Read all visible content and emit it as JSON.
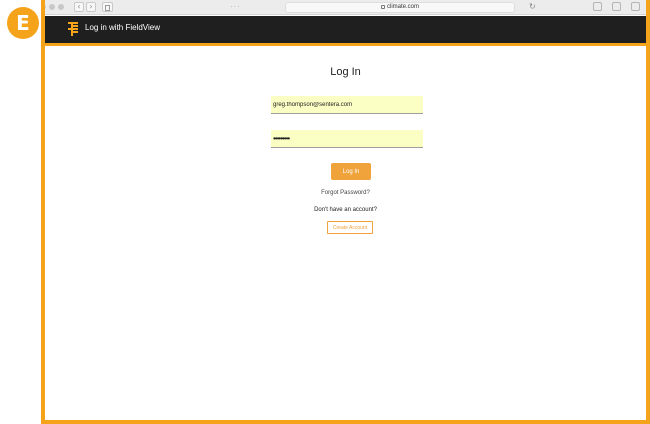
{
  "step_badge": "E",
  "browser": {
    "url": "climate.com",
    "colors": {
      "chrome_bg": "#ececec"
    }
  },
  "header": {
    "title": "Log in with FieldView",
    "logo_icon": "fieldview-logo-icon",
    "colors": {
      "bar": "#1f1f1f",
      "accent": "#f5a31a"
    }
  },
  "login": {
    "title": "Log In",
    "email_value": "greg.thompson@sentera.com",
    "password_value": "•••••••••",
    "submit_label": "Log In",
    "forgot_label": "Forgot Password?",
    "no_account_text": "Don't have an account?",
    "create_label": "Create Account",
    "colors": {
      "field_bg": "#fbffc4",
      "button": "#f0a23b"
    }
  }
}
